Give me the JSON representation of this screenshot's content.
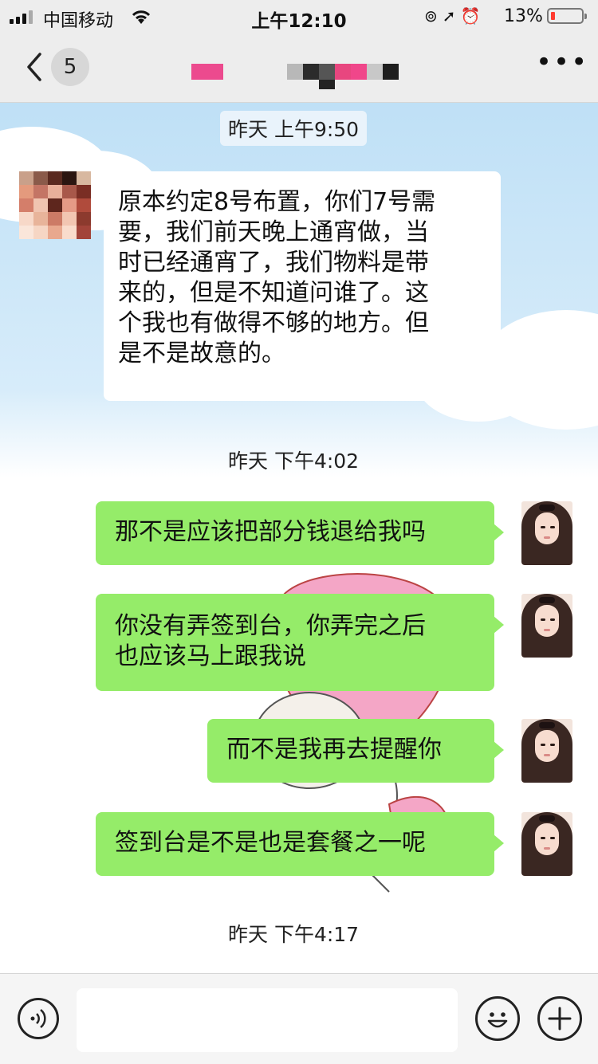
{
  "status_bar": {
    "carrier": "中国移动",
    "time": "上午12:10",
    "battery_percent": "13%",
    "battery_level": 0.13,
    "battery_color": "#ff3b30"
  },
  "nav": {
    "unread_count": "5",
    "icons": {
      "back": "chevron-left-icon",
      "more": "ellipsis-icon"
    }
  },
  "chat": {
    "timestamps": [
      "昨天 上午9:50",
      "昨天 下午4:02",
      "昨天 下午4:17"
    ],
    "incoming": [
      {
        "lines": [
          "原本约定8号布置，你们7号需",
          "要，我们前天晚上通宵做，当",
          "时已经通宵了，我们物料是带",
          "来的，但是不知道问谁了。这",
          "个我也有做得不够的地方。但",
          "是不是故意的。"
        ]
      }
    ],
    "outgoing": [
      {
        "lines": [
          "那不是应该把部分钱退给我吗"
        ]
      },
      {
        "lines": [
          "你没有弄签到台，你弄完之后",
          "也应该马上跟我说"
        ]
      },
      {
        "lines": [
          "而不是我再去提醒你"
        ]
      },
      {
        "lines": [
          "签到台是不是也是套餐之一呢"
        ]
      }
    ],
    "colors": {
      "outgoing_bubble": "#95ec69",
      "incoming_bubble": "#ffffff"
    }
  },
  "input_bar": {
    "placeholder": "",
    "icons": {
      "voice": "voice-icon",
      "emoji": "emoji-icon",
      "more": "plus-icon"
    }
  }
}
